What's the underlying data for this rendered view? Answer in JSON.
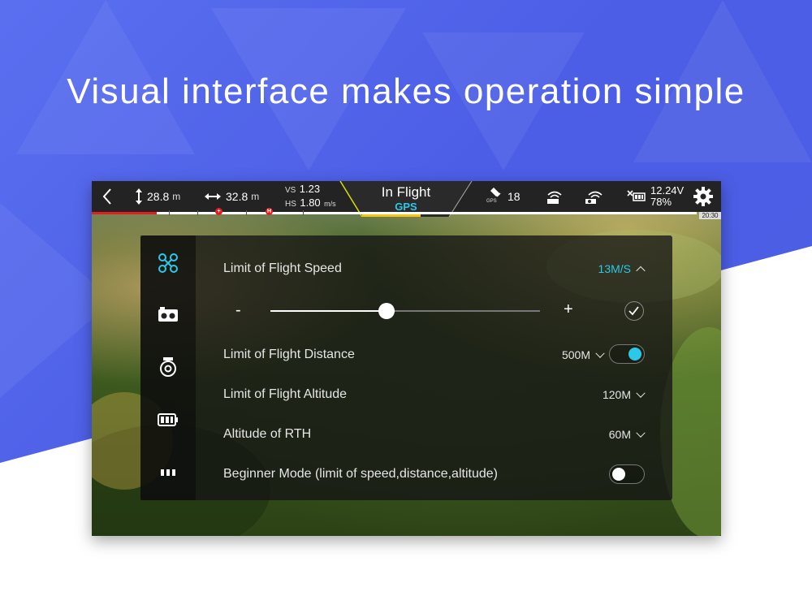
{
  "headline": "Visual interface makes operation simple",
  "topbar": {
    "height_value": "28.8",
    "height_unit": "m",
    "distance_value": "32.8",
    "distance_unit": "m",
    "vs_label": "VS",
    "vs_value": "1.23",
    "hs_label": "HS",
    "hs_value": "1.80",
    "speed_unit": "m/s",
    "flight_mode": "In Flight",
    "positioning": "GPS",
    "satellite_label": "GPS",
    "satellite_count": "18",
    "battery_voltage": "12.24V",
    "battery_percent": "78%",
    "time": "20:30",
    "marker_a": "+",
    "marker_b": "H",
    "icons": [
      "back-icon",
      "altitude-icon",
      "distance-icon",
      "satellite-icon",
      "remote-signal-icon",
      "image-signal-icon",
      "battery-icon",
      "settings-icon"
    ]
  },
  "sidebar": {
    "items": [
      "drone-settings",
      "camera-settings",
      "gimbal-settings",
      "battery-settings",
      "more-settings"
    ],
    "active": "drone-settings"
  },
  "settings": {
    "speed": {
      "label": "Limit of Flight Speed",
      "value": "13M/S",
      "slider_minus": "-",
      "slider_plus": "+",
      "slider_fraction": 0.43
    },
    "distance": {
      "label": "Limit of Flight Distance",
      "value": "500M",
      "enabled": true
    },
    "altitude": {
      "label": "Limit of Flight Altitude",
      "value": "120M"
    },
    "rth": {
      "label": "Altitude of RTH",
      "value": "60M"
    },
    "beginner": {
      "label": "Beginner Mode (limit of speed,distance,altitude)",
      "enabled": false
    }
  },
  "colors": {
    "accent": "#2cc8e8",
    "background_blue": "#4c5ee6",
    "gps_bar": "#f5c518",
    "alert": "#e02020"
  }
}
